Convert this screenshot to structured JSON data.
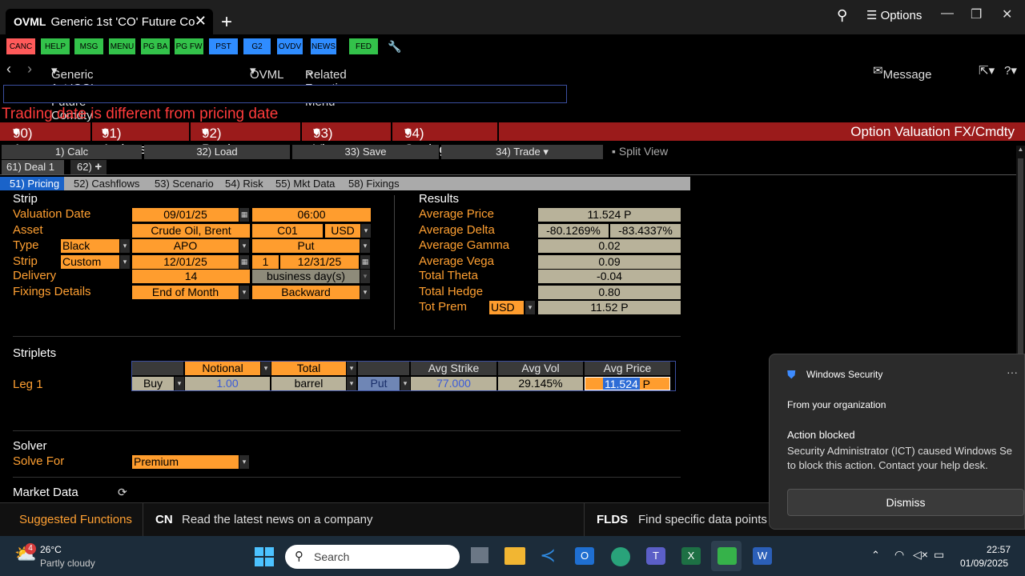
{
  "window": {
    "tab_code": "OVML",
    "tab_title": "Generic 1st 'CO' Future Co",
    "options_label": "Options"
  },
  "launchpad": [
    {
      "label": "CANC",
      "color": "#ff5a5a"
    },
    {
      "label": "HELP",
      "color": "#33c24a"
    },
    {
      "label": "MSG",
      "color": "#33c24a"
    },
    {
      "label": "MENU",
      "color": "#33c24a"
    },
    {
      "label": "PG BA",
      "color": "#33c24a"
    },
    {
      "label": "PG FW",
      "color": "#33c24a"
    },
    {
      "label": "PST",
      "color": "#2f8cff"
    },
    {
      "label": "G2",
      "color": "#2f8cff"
    },
    {
      "label": "OVDV",
      "color": "#2f8cff"
    },
    {
      "label": "NEWS",
      "color": "#2f8cff"
    },
    {
      "label": "FED",
      "color": "#33c24a"
    }
  ],
  "nav": {
    "security": "Generic 1st 'CO' Future Comdty",
    "function": "OVML",
    "related": "Related Functions Menu",
    "message": "Message"
  },
  "warning": "Trading date is different from pricing date",
  "menu": {
    "asset": "90) Asset",
    "actions": "91) Actions",
    "products": "92) Products",
    "views": "93) Views",
    "settings": "94) Settings",
    "title": "Option Valuation FX/Cmdty"
  },
  "toolbar": {
    "calc": "1) Calc",
    "load": "32) Load",
    "save": "33) Save",
    "trade": "34) Trade",
    "split": "Split View"
  },
  "deals": {
    "deal1": "61) Deal 1",
    "new": "62)"
  },
  "subtabs": [
    "51) Pricing",
    "52) Cashflows",
    "53) Scenario",
    "54) Risk",
    "55) Mkt Data",
    "58) Fixings"
  ],
  "strip": {
    "header": "Strip",
    "valuation_date_label": "Valuation Date",
    "valuation_date": "09/01/25",
    "valuation_time": "06:00",
    "asset_label": "Asset",
    "asset": "Crude Oil, Brent",
    "asset_code": "C01",
    "currency": "USD",
    "type_label": "Type",
    "type": "Black",
    "model": "APO",
    "option": "Put",
    "strip_label": "Strip",
    "strip_type": "Custom",
    "start": "12/01/25",
    "count": "1",
    "end": "12/31/25",
    "delivery_label": "Delivery",
    "delivery": "14",
    "delivery_unit": "business day(s)",
    "fixings_label": "Fixings Details",
    "fixings": "End of Month",
    "direction": "Backward"
  },
  "results": {
    "header": "Results",
    "avg_price_label": "Average Price",
    "avg_price": "11.524 P",
    "avg_delta_label": "Average Delta",
    "avg_delta_1": "-80.1269%",
    "avg_delta_2": "-83.4337%",
    "avg_gamma_label": "Average Gamma",
    "avg_gamma": "0.02",
    "avg_vega_label": "Average Vega",
    "avg_vega": "0.09",
    "theta_label": "Total Theta",
    "theta": "-0.04",
    "hedge_label": "Total Hedge",
    "hedge": "0.80",
    "prem_label": "Tot Prem",
    "prem_ccy": "USD",
    "prem": "11.52 P"
  },
  "striplets": {
    "header": "Striplets",
    "notional_h": "Notional",
    "total_h": "Total",
    "strike_h": "Avg Strike",
    "vol_h": "Avg Vol",
    "price_h": "Avg Price",
    "leg_label": "Leg 1",
    "side": "Buy",
    "notional": "1.00",
    "unit": "barrel",
    "opt": "Put",
    "strike": "77.000",
    "vol": "29.145%",
    "price": "11.524",
    "price_suffix": "P"
  },
  "solver": {
    "header": "Solver",
    "solve_for_label": "Solve For",
    "solve_for": "Premium"
  },
  "market_data": "Market Data",
  "bottom": {
    "suggested": "Suggested Functions",
    "cn_code": "CN",
    "cn_text": "Read the latest news on a company",
    "flds_code": "FLDS",
    "flds_text": "Find specific data points"
  },
  "toast": {
    "app": "Windows Security",
    "org": "From your organization",
    "title": "Action blocked",
    "body1": "Security Administrator (ICT) caused Windows Se",
    "body2": "to block this action. Contact your help desk.",
    "dismiss": "Dismiss"
  },
  "taskbar": {
    "badge": "4",
    "temp": "26°C",
    "weather": "Partly cloudy",
    "search": "Search",
    "time": "22:57",
    "date": "01/09/2025"
  }
}
